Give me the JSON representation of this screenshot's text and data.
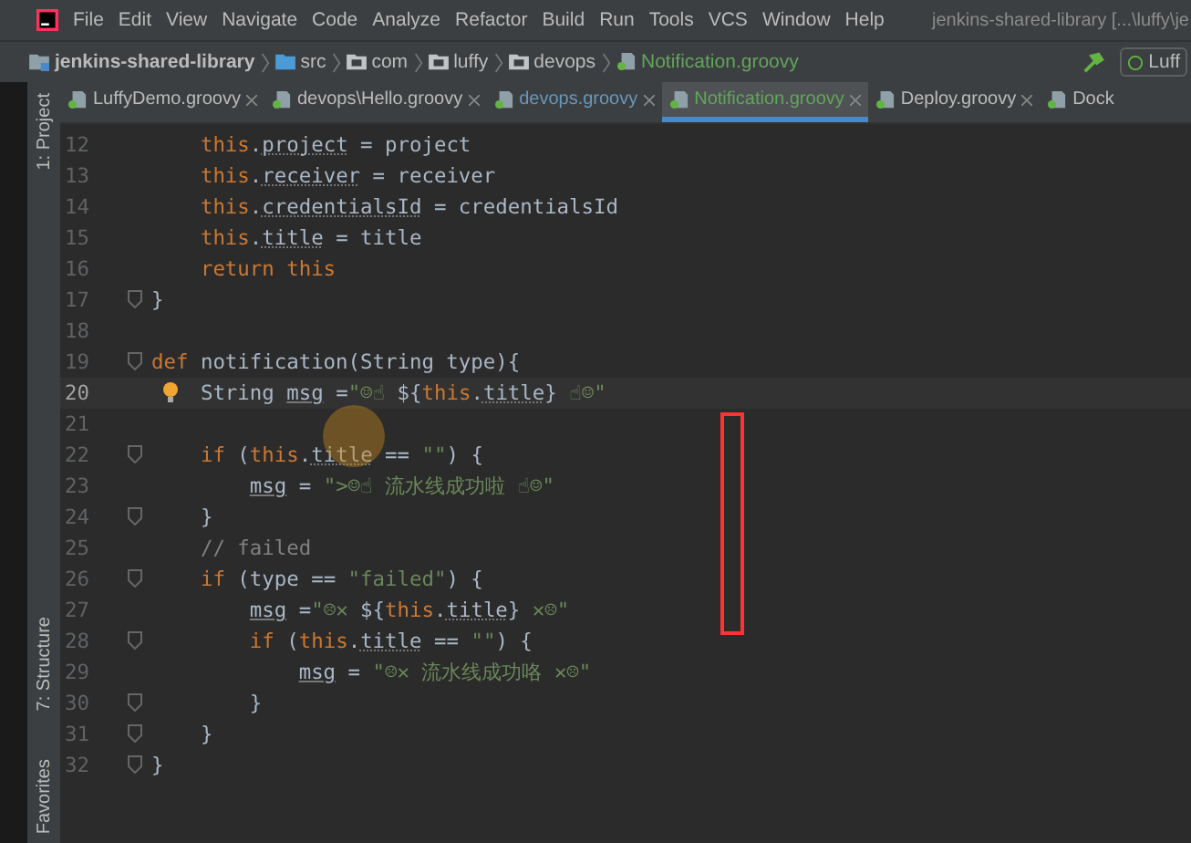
{
  "menu": [
    "File",
    "Edit",
    "View",
    "Navigate",
    "Code",
    "Analyze",
    "Refactor",
    "Build",
    "Run",
    "Tools",
    "VCS",
    "Window",
    "Help"
  ],
  "window": {
    "title": "jenkins-shared-library [...\\luffy\\je"
  },
  "breadcrumb": [
    {
      "label": "jenkins-shared-library",
      "kind": "project"
    },
    {
      "label": "src",
      "kind": "source"
    },
    {
      "label": "com",
      "kind": "folder"
    },
    {
      "label": "luffy",
      "kind": "folder"
    },
    {
      "label": "devops",
      "kind": "folder"
    },
    {
      "label": "Notification.groovy",
      "kind": "file"
    }
  ],
  "run_config": "Luff",
  "tabs": [
    {
      "label": "LuffyDemo.groovy",
      "selected": false,
      "modified": false,
      "closable": true
    },
    {
      "label": "devops\\Hello.groovy",
      "selected": false,
      "modified": false,
      "closable": true
    },
    {
      "label": "devops.groovy",
      "selected": false,
      "modified": true,
      "closable": true
    },
    {
      "label": "Notification.groovy",
      "selected": true,
      "modified": false,
      "closable": true
    },
    {
      "label": "Deploy.groovy",
      "selected": false,
      "modified": false,
      "closable": true
    },
    {
      "label": "Dock",
      "selected": false,
      "modified": false,
      "closable": false
    }
  ],
  "tool_windows_top": [
    "1: Project"
  ],
  "tool_windows_bottom": [
    "7: Structure",
    "Favorites"
  ],
  "editor": {
    "lines": [
      {
        "number": "12",
        "current": false,
        "fold": false,
        "bulb": false,
        "segments": [
          {
            "t": "    this",
            "kind": "kw"
          },
          {
            "t": ".",
            "kind": "plain"
          },
          {
            "t": "project",
            "kind": "field"
          },
          {
            "t": " = project",
            "kind": "plain"
          }
        ]
      },
      {
        "number": "13",
        "current": false,
        "fold": false,
        "bulb": false,
        "segments": [
          {
            "t": "    this",
            "kind": "kw"
          },
          {
            "t": ".",
            "kind": "plain"
          },
          {
            "t": "receiver",
            "kind": "field"
          },
          {
            "t": " = receiver",
            "kind": "plain"
          }
        ]
      },
      {
        "number": "14",
        "current": false,
        "fold": false,
        "bulb": false,
        "segments": [
          {
            "t": "    this",
            "kind": "kw"
          },
          {
            "t": ".",
            "kind": "plain"
          },
          {
            "t": "credentialsId",
            "kind": "field"
          },
          {
            "t": " = credentialsId",
            "kind": "plain"
          }
        ]
      },
      {
        "number": "15",
        "current": false,
        "fold": false,
        "bulb": false,
        "segments": [
          {
            "t": "    this",
            "kind": "kw"
          },
          {
            "t": ".",
            "kind": "plain"
          },
          {
            "t": "title",
            "kind": "field"
          },
          {
            "t": " = title",
            "kind": "plain"
          }
        ]
      },
      {
        "number": "16",
        "current": false,
        "fold": false,
        "bulb": false,
        "segments": [
          {
            "t": "    return this",
            "kind": "kw"
          }
        ]
      },
      {
        "number": "17",
        "current": false,
        "fold": true,
        "bulb": false,
        "segments": [
          {
            "t": "}",
            "kind": "plain"
          }
        ]
      },
      {
        "number": "18",
        "current": false,
        "fold": false,
        "bulb": false
      },
      {
        "number": "19",
        "current": false,
        "fold": true,
        "bulb": false,
        "segments": [
          {
            "t": "def",
            "kind": "kw"
          },
          {
            "t": " notification(String type){",
            "kind": "plain"
          }
        ]
      },
      {
        "number": "20",
        "current": true,
        "fold": false,
        "bulb": true,
        "segments": [
          {
            "t": "    String ",
            "kind": "plain"
          },
          {
            "t": "msg",
            "kind": "var"
          },
          {
            "t": " =",
            "kind": "plain"
          },
          {
            "t": "\"☺☝ ",
            "kind": "string"
          },
          {
            "t": "${",
            "kind": "plain"
          },
          {
            "t": "this",
            "kind": "kw"
          },
          {
            "t": ".",
            "kind": "plain"
          },
          {
            "t": "title",
            "kind": "field"
          },
          {
            "t": "}",
            "kind": "plain"
          },
          {
            "t": " ☝☺\"",
            "kind": "string"
          }
        ]
      },
      {
        "number": "21",
        "current": false,
        "fold": false,
        "bulb": false
      },
      {
        "number": "22",
        "current": false,
        "fold": true,
        "bulb": false,
        "segments": [
          {
            "t": "    if",
            "kind": "kw"
          },
          {
            "t": " (",
            "kind": "plain"
          },
          {
            "t": "this",
            "kind": "kw"
          },
          {
            "t": ".",
            "kind": "plain"
          },
          {
            "t": "title",
            "kind": "field"
          },
          {
            "t": " == ",
            "kind": "plain"
          },
          {
            "t": "\"\"",
            "kind": "string"
          },
          {
            "t": ") {",
            "kind": "plain"
          }
        ]
      },
      {
        "number": "23",
        "current": false,
        "fold": false,
        "bulb": false,
        "segments": [
          {
            "t": "        msg",
            "kind": "var"
          },
          {
            "t": " = ",
            "kind": "plain"
          },
          {
            "t": "\">☺☝ 流水线成功啦 ☝☺\"",
            "kind": "string"
          }
        ]
      },
      {
        "number": "24",
        "current": false,
        "fold": true,
        "bulb": false,
        "segments": [
          {
            "t": "    }",
            "kind": "plain"
          }
        ]
      },
      {
        "number": "25",
        "current": false,
        "fold": false,
        "bulb": false,
        "segments": [
          {
            "t": "    // failed",
            "kind": "comment"
          }
        ]
      },
      {
        "number": "26",
        "current": false,
        "fold": true,
        "bulb": false,
        "segments": [
          {
            "t": "    if",
            "kind": "kw"
          },
          {
            "t": " (type == ",
            "kind": "plain"
          },
          {
            "t": "\"failed\"",
            "kind": "string"
          },
          {
            "t": ") {",
            "kind": "plain"
          }
        ]
      },
      {
        "number": "27",
        "current": false,
        "fold": false,
        "bulb": false,
        "segments": [
          {
            "t": "        msg",
            "kind": "var"
          },
          {
            "t": " =",
            "kind": "plain"
          },
          {
            "t": "\"☹✕ ",
            "kind": "string"
          },
          {
            "t": "${",
            "kind": "plain"
          },
          {
            "t": "this",
            "kind": "kw"
          },
          {
            "t": ".",
            "kind": "plain"
          },
          {
            "t": "title",
            "kind": "field"
          },
          {
            "t": "}",
            "kind": "plain"
          },
          {
            "t": " ✕☹\"",
            "kind": "string"
          }
        ]
      },
      {
        "number": "28",
        "current": false,
        "fold": true,
        "bulb": false,
        "segments": [
          {
            "t": "        if",
            "kind": "kw"
          },
          {
            "t": " (",
            "kind": "plain"
          },
          {
            "t": "this",
            "kind": "kw"
          },
          {
            "t": ".",
            "kind": "plain"
          },
          {
            "t": "title",
            "kind": "field"
          },
          {
            "t": " == ",
            "kind": "plain"
          },
          {
            "t": "\"\"",
            "kind": "string"
          },
          {
            "t": ") {",
            "kind": "plain"
          }
        ]
      },
      {
        "number": "29",
        "current": false,
        "fold": false,
        "bulb": false,
        "segments": [
          {
            "t": "            msg",
            "kind": "var"
          },
          {
            "t": " = ",
            "kind": "plain"
          },
          {
            "t": "\"☹✕ 流水线成功咯 ✕☹\"",
            "kind": "string"
          }
        ]
      },
      {
        "number": "30",
        "current": false,
        "fold": true,
        "bulb": false,
        "segments": [
          {
            "t": "        }",
            "kind": "plain"
          }
        ]
      },
      {
        "number": "31",
        "current": false,
        "fold": true,
        "bulb": false,
        "segments": [
          {
            "t": "    }",
            "kind": "plain"
          }
        ]
      },
      {
        "number": "32",
        "current": false,
        "fold": true,
        "bulb": false,
        "segments": [
          {
            "t": "}",
            "kind": "plain"
          }
        ]
      }
    ]
  }
}
